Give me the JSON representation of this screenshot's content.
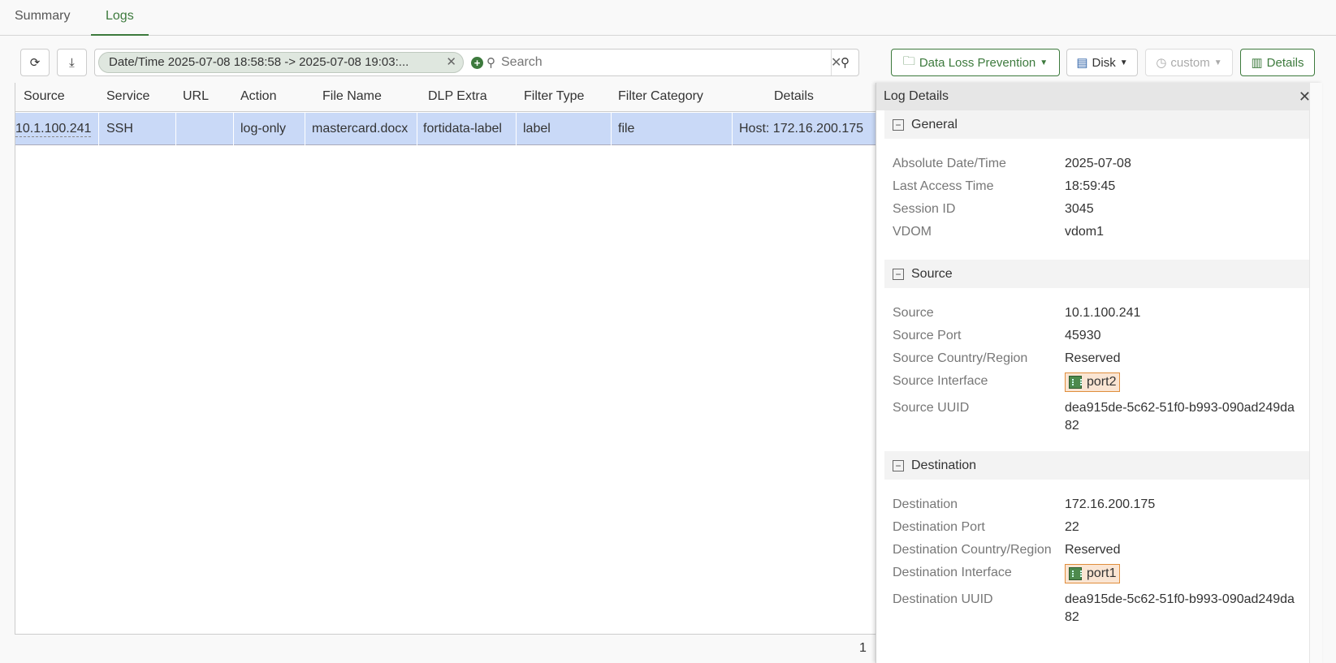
{
  "tabs": [
    "Summary",
    "Logs"
  ],
  "toolbar": {
    "filter_chip": "Date/Time 2025-07-08 18:58:58 -> 2025-07-08 19:03:...",
    "search_placeholder": "Search",
    "log_type": "Data Loss Prevention",
    "storage": "Disk",
    "time_range": "custom",
    "details": "Details"
  },
  "table": {
    "columns": [
      "Source",
      "Service",
      "URL",
      "Action",
      "File Name",
      "DLP Extra",
      "Filter Type",
      "Filter Category",
      "Details"
    ],
    "rows": [
      [
        "10.1.100.241",
        "SSH",
        "",
        "log-only",
        "mastercard.docx",
        "fortidata-label",
        "label",
        "file",
        "Host: 172.16.200.175"
      ]
    ]
  },
  "pager": {
    "page": "1"
  },
  "panel": {
    "title": "Log Details",
    "general": {
      "title": "General",
      "rows": [
        [
          "Absolute Date/Time",
          "2025-07-08"
        ],
        [
          "Last Access Time",
          "18:59:45"
        ],
        [
          "Session ID",
          "3045"
        ],
        [
          "VDOM",
          "vdom1"
        ]
      ]
    },
    "source": {
      "title": "Source",
      "rows": [
        [
          "Source",
          "10.1.100.241"
        ],
        [
          "Source Port",
          "45930"
        ],
        [
          "Source Country/Region",
          "Reserved"
        ],
        [
          "Source Interface",
          "port2"
        ],
        [
          "Source UUID",
          "dea915de-5c62-51f0-b993-090ad249da82"
        ]
      ]
    },
    "destination": {
      "title": "Destination",
      "rows": [
        [
          "Destination",
          "172.16.200.175"
        ],
        [
          "Destination Port",
          "22"
        ],
        [
          "Destination Country/Region",
          "Reserved"
        ],
        [
          "Destination Interface",
          "port1"
        ],
        [
          "Destination UUID",
          "dea915de-5c62-51f0-b993-090ad249da82"
        ]
      ]
    }
  }
}
